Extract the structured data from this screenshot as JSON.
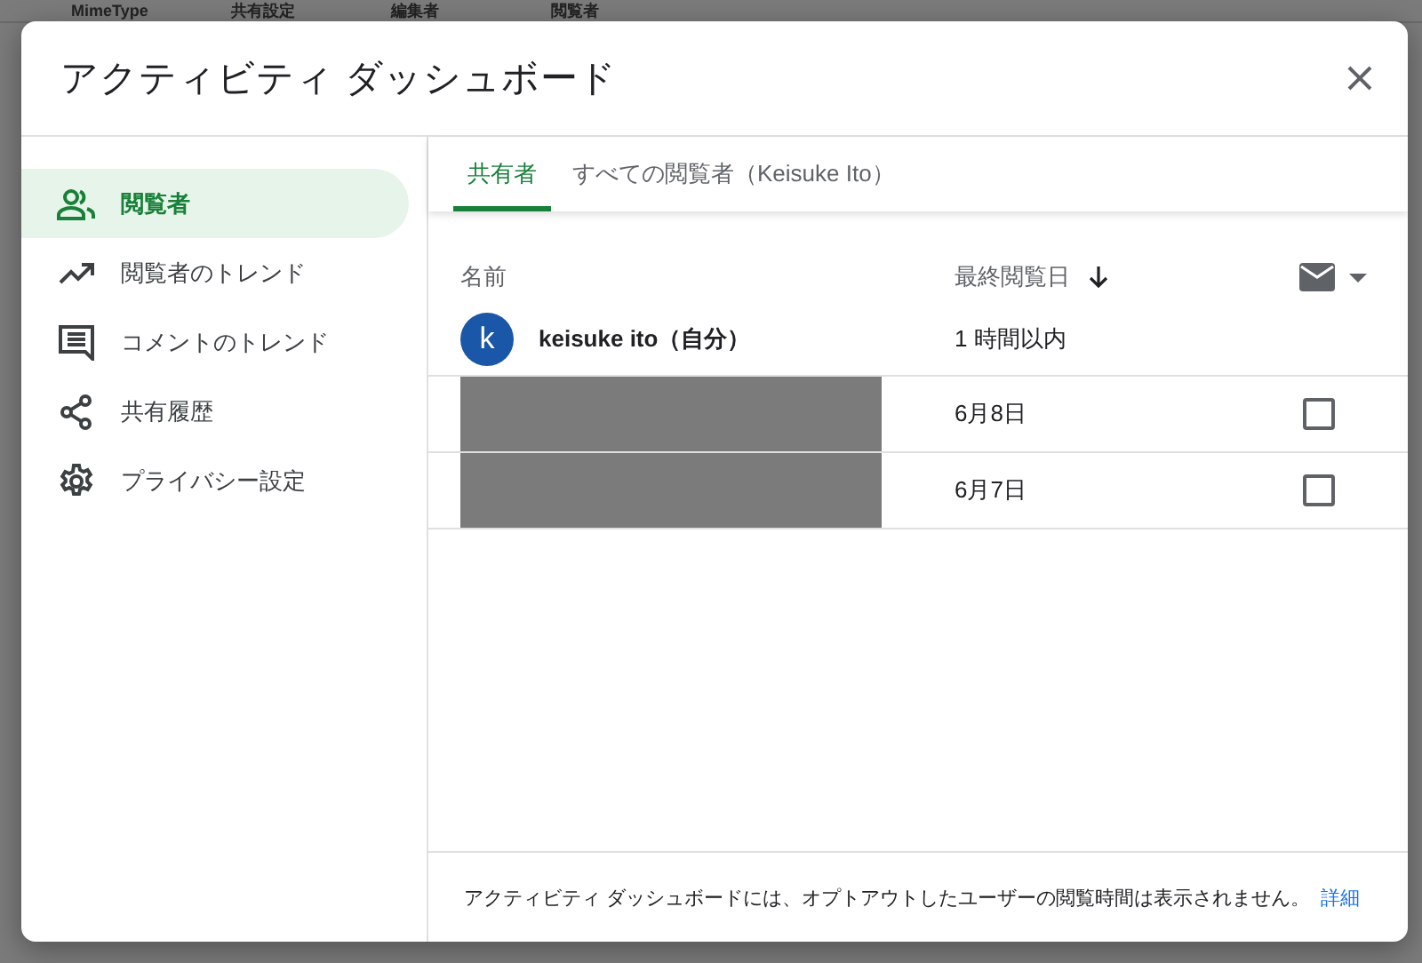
{
  "background_sheet": {
    "headers": [
      "MimeType",
      "共有設定",
      "編集者",
      "閲覧者"
    ]
  },
  "window": {
    "title": "アクティビティ ダッシュボード"
  },
  "sidebar": {
    "items": [
      {
        "label": "閲覧者",
        "selected": true
      },
      {
        "label": "閲覧者のトレンド",
        "selected": false
      },
      {
        "label": "コメントのトレンド",
        "selected": false
      },
      {
        "label": "共有履歴",
        "selected": false
      },
      {
        "label": "プライバシー設定",
        "selected": false
      }
    ]
  },
  "tabs": [
    {
      "label": "共有者",
      "selected": true
    },
    {
      "label": "すべての閲覧者（Keisuke Ito）",
      "selected": false
    }
  ],
  "table": {
    "columns": [
      "名前",
      "最終閲覧日"
    ],
    "rows": [
      {
        "kind": "self",
        "avatar": "k",
        "name": "keisuke ito（自分）",
        "last_viewed": "1 時間以内"
      },
      {
        "kind": "redacted",
        "last_viewed": "6月8日",
        "checked": false
      },
      {
        "kind": "redacted",
        "last_viewed": "6月7日",
        "checked": false
      }
    ]
  },
  "footer": {
    "text": "アクティビティ ダッシュボードには、オプトアウトしたユーザーの閲覧時間は表示されません。",
    "link": "詳細"
  }
}
